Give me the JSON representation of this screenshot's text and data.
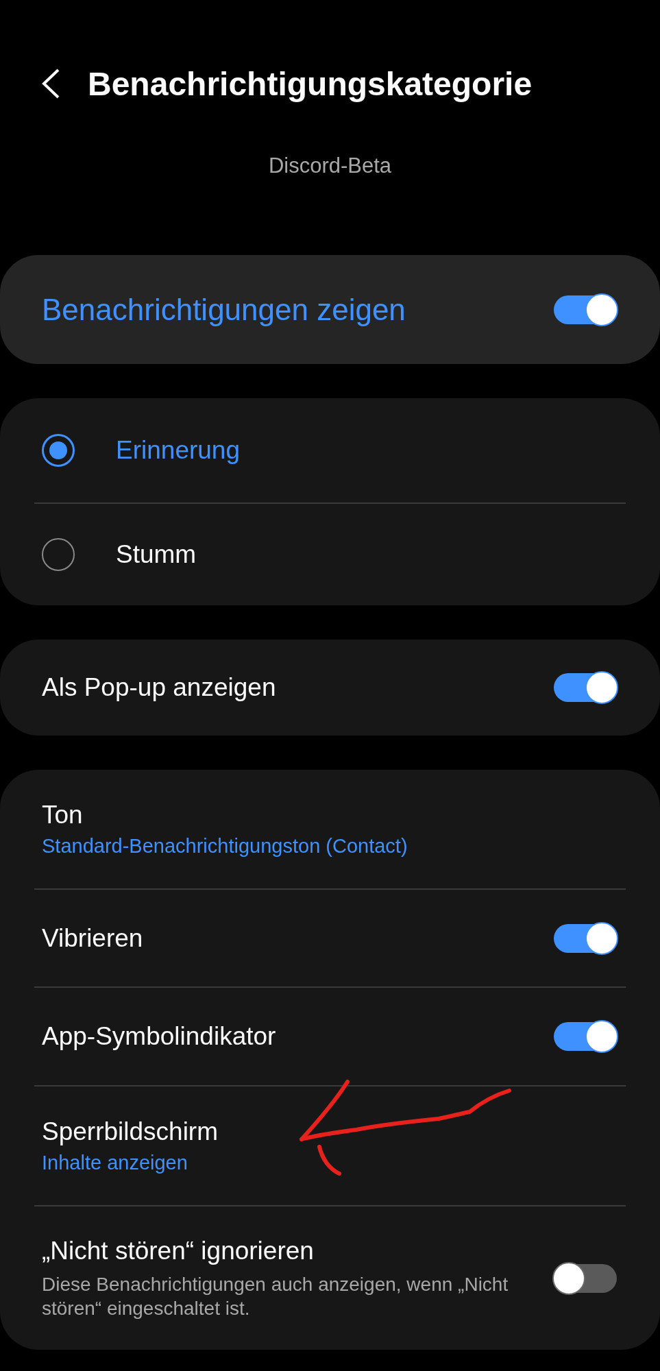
{
  "header": {
    "title": "Benachrichtigungskategorie",
    "subtitle": "Discord-Beta"
  },
  "master": {
    "label": "Benachrichtigungen zeigen",
    "on": true
  },
  "importance": [
    {
      "label": "Erinnerung",
      "selected": true
    },
    {
      "label": "Stumm",
      "selected": false
    }
  ],
  "popup": {
    "label": "Als Pop-up anzeigen",
    "on": true
  },
  "settings": [
    {
      "kind": "link",
      "title": "Ton",
      "value": "Standard-Benachrichtigungston (Contact)"
    },
    {
      "kind": "toggle",
      "title": "Vibrieren",
      "on": true
    },
    {
      "kind": "toggle",
      "title": "App-Symbolindikator",
      "on": true
    },
    {
      "kind": "link",
      "title": "Sperrbildschirm",
      "value": "Inhalte anzeigen"
    },
    {
      "kind": "toggle",
      "title": "„Nicht stören“ ignorieren",
      "description": "Diese Benachrichtigungen auch anzeigen, wenn „Nicht stören“ eingeschaltet ist.",
      "on": false
    }
  ]
}
